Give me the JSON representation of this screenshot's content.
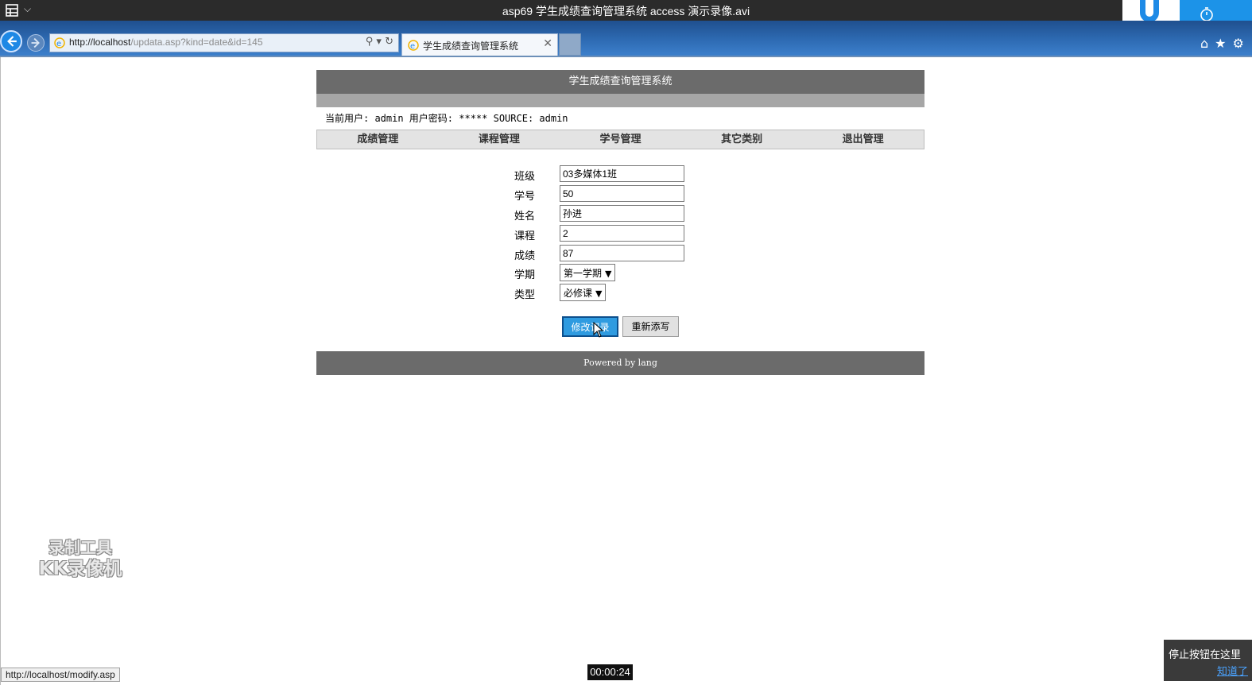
{
  "window": {
    "title": "asp69 学生成绩查询管理系统 access 演示录像.avi"
  },
  "browser": {
    "url_host": "http://localhost",
    "url_path": "/updata.asp?kind=date&id=145",
    "tab_title": "学生成绩查询管理系统",
    "status_url": "http://localhost/modify.asp"
  },
  "page": {
    "header_title": "学生成绩查询管理系统",
    "user_line": "当前用户: admin  用户密码: ***** SOURCE:  admin",
    "nav": [
      "成绩管理",
      "课程管理",
      "学号管理",
      "其它类别",
      "退出管理"
    ],
    "form": {
      "class_label": "班级",
      "class_value": "03多媒体1班",
      "student_no_label": "学号",
      "student_no_value": "50",
      "name_label": "姓名",
      "name_value": "孙进",
      "course_label": "课程",
      "course_value": "2",
      "score_label": "成绩",
      "score_value": "87",
      "term_label": "学期",
      "term_value": "第一学期",
      "type_label": "类型",
      "type_value": "必修课"
    },
    "buttons": {
      "submit": "修改记录",
      "reset": "重新添写"
    },
    "footer": "Powered by lang"
  },
  "overlay": {
    "watermark_line1": "录制工具",
    "watermark_line2": "KK录像机",
    "timer": "00:00:24",
    "tip_text": "停止按钮在这里",
    "tip_link": "知道了"
  },
  "colors": {
    "header_bg": "#6b6b6b",
    "subheader_bg": "#a6a6a6",
    "submit_bg": "#2f9be0",
    "browser_bar": "#2e6bb3"
  }
}
